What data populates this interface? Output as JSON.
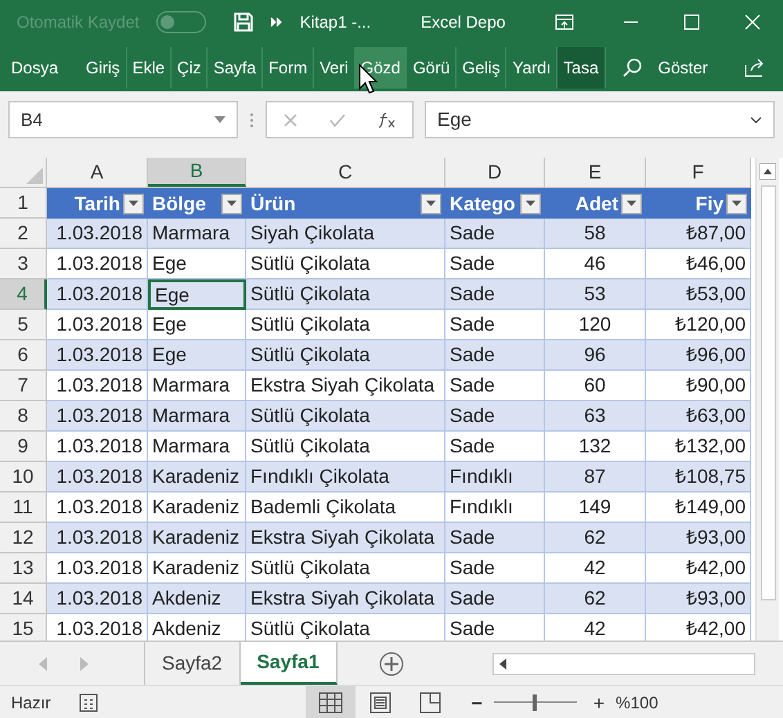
{
  "title_bar": {
    "autosave_label": "Otomatik Kaydet",
    "autosave_on": false,
    "file_title": "Kitap1  -...",
    "app_name": "Excel Depo"
  },
  "ribbon_tabs": [
    {
      "label": "Dosya",
      "hovered": false,
      "contextual": false
    },
    {
      "label": "Giriş",
      "hovered": false,
      "contextual": false
    },
    {
      "label": "Ekle",
      "hovered": false,
      "contextual": false
    },
    {
      "label": "Çiz",
      "hovered": false,
      "contextual": false
    },
    {
      "label": "Sayfa",
      "hovered": false,
      "contextual": false
    },
    {
      "label": "Form",
      "hovered": false,
      "contextual": false
    },
    {
      "label": "Veri",
      "hovered": false,
      "contextual": false
    },
    {
      "label": "Gözd",
      "hovered": true,
      "contextual": false
    },
    {
      "label": "Görü",
      "hovered": false,
      "contextual": false
    },
    {
      "label": "Geliş",
      "hovered": false,
      "contextual": false
    },
    {
      "label": "Yardı",
      "hovered": false,
      "contextual": false
    },
    {
      "label": "Tasa",
      "hovered": false,
      "contextual": true
    }
  ],
  "tell_me": "Göster",
  "formula_bar": {
    "name_box": "B4",
    "value": "Ege"
  },
  "columns": [
    {
      "label": "A",
      "selected": false
    },
    {
      "label": "B",
      "selected": true
    },
    {
      "label": "C",
      "selected": false
    },
    {
      "label": "D",
      "selected": false
    },
    {
      "label": "E",
      "selected": false
    },
    {
      "label": "F",
      "selected": false
    }
  ],
  "table": {
    "header_row": "1",
    "headers": [
      {
        "label": "Tarih",
        "kind": "date"
      },
      {
        "label": "Bölge",
        "kind": "text"
      },
      {
        "label": "Ürün",
        "kind": "text"
      },
      {
        "label": "Katego",
        "kind": "text"
      },
      {
        "label": "Adet",
        "kind": "count"
      },
      {
        "label": "Fiy",
        "kind": "currency"
      }
    ],
    "rows": [
      {
        "number": "2",
        "selected": false,
        "cells": [
          "1.03.2018",
          "Marmara",
          "Siyah Çikolata",
          "Sade",
          "58",
          "₺87,00"
        ]
      },
      {
        "number": "3",
        "selected": false,
        "cells": [
          "1.03.2018",
          "Ege",
          "Sütlü Çikolata",
          "Sade",
          "46",
          "₺46,00"
        ]
      },
      {
        "number": "4",
        "selected": true,
        "cells": [
          "1.03.2018",
          "Ege",
          "Sütlü Çikolata",
          "Sade",
          "53",
          "₺53,00"
        ]
      },
      {
        "number": "5",
        "selected": false,
        "cells": [
          "1.03.2018",
          "Ege",
          "Sütlü Çikolata",
          "Sade",
          "120",
          "₺120,00"
        ]
      },
      {
        "number": "6",
        "selected": false,
        "cells": [
          "1.03.2018",
          "Ege",
          "Sütlü Çikolata",
          "Sade",
          "96",
          "₺96,00"
        ]
      },
      {
        "number": "7",
        "selected": false,
        "cells": [
          "1.03.2018",
          "Marmara",
          "Ekstra Siyah Çikolata",
          "Sade",
          "60",
          "₺90,00"
        ]
      },
      {
        "number": "8",
        "selected": false,
        "cells": [
          "1.03.2018",
          "Marmara",
          "Sütlü Çikolata",
          "Sade",
          "63",
          "₺63,00"
        ]
      },
      {
        "number": "9",
        "selected": false,
        "cells": [
          "1.03.2018",
          "Marmara",
          "Sütlü Çikolata",
          "Sade",
          "132",
          "₺132,00"
        ]
      },
      {
        "number": "10",
        "selected": false,
        "cells": [
          "1.03.2018",
          "Karadeniz",
          "Fındıklı Çikolata",
          "Fındıklı",
          "87",
          "₺108,75"
        ]
      },
      {
        "number": "11",
        "selected": false,
        "cells": [
          "1.03.2018",
          "Karadeniz",
          "Bademli Çikolata",
          "Fındıklı",
          "149",
          "₺149,00"
        ]
      },
      {
        "number": "12",
        "selected": false,
        "cells": [
          "1.03.2018",
          "Karadeniz",
          "Ekstra Siyah Çikolata",
          "Sade",
          "62",
          "₺93,00"
        ]
      },
      {
        "number": "13",
        "selected": false,
        "cells": [
          "1.03.2018",
          "Karadeniz",
          "Sütlü Çikolata",
          "Sade",
          "42",
          "₺42,00"
        ]
      },
      {
        "number": "14",
        "selected": false,
        "cells": [
          "1.03.2018",
          "Akdeniz",
          "Ekstra Siyah Çikolata",
          "Sade",
          "62",
          "₺93,00"
        ]
      },
      {
        "number": "15",
        "selected": false,
        "cells": [
          "1.03.2018",
          "Akdeniz",
          "Sütlü Çikolata",
          "Sade",
          "42",
          "₺42,00"
        ]
      }
    ]
  },
  "sheet_tabs": [
    {
      "label": "Sayfa2",
      "selected": false
    },
    {
      "label": "Sayfa1",
      "selected": true
    }
  ],
  "status_bar": {
    "status": "Hazır",
    "views": [
      {
        "kind": "normal",
        "selected": true
      },
      {
        "kind": "layout",
        "selected": false
      },
      {
        "kind": "pagebreak",
        "selected": false
      }
    ],
    "zoom": {
      "level": 0.5,
      "minus": "−",
      "plus": "+",
      "label": "%100"
    }
  }
}
